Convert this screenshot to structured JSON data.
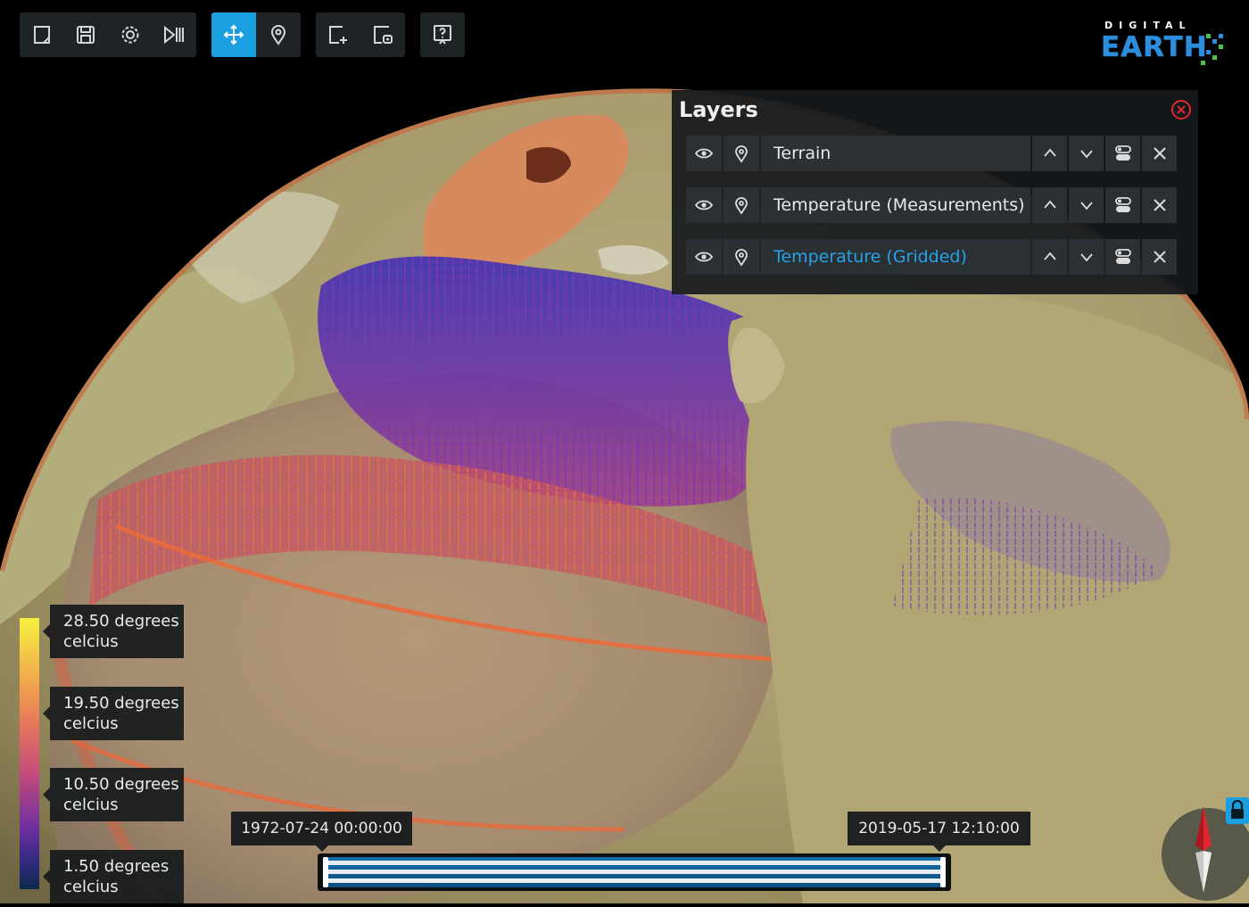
{
  "app": {
    "logo_top": "DIGITAL",
    "logo_main": "EARTH"
  },
  "toolbar": {
    "groups": [
      {
        "buttons": [
          {
            "icon": "new-document-icon",
            "active": false
          },
          {
            "icon": "save-icon",
            "active": false
          },
          {
            "icon": "gear-icon",
            "active": false
          },
          {
            "icon": "play-pause-icon",
            "active": false
          }
        ]
      },
      {
        "buttons": [
          {
            "icon": "move-icon",
            "active": true
          },
          {
            "icon": "map-pin-icon",
            "active": false
          }
        ]
      },
      {
        "buttons": [
          {
            "icon": "add-layer-icon",
            "active": false
          },
          {
            "icon": "layer-settings-icon",
            "active": false
          }
        ]
      },
      {
        "buttons": [
          {
            "icon": "help-icon",
            "active": false
          }
        ]
      }
    ]
  },
  "layers": {
    "title": "Layers",
    "items": [
      {
        "label": "Terrain",
        "highlighted": false
      },
      {
        "label": "Temperature (Measurements)",
        "highlighted": false
      },
      {
        "label": "Temperature (Gridded)",
        "highlighted": true
      }
    ]
  },
  "legend": {
    "items": [
      {
        "line1": "28.50 degrees",
        "line2": "celcius"
      },
      {
        "line1": "19.50 degrees",
        "line2": "celcius"
      },
      {
        "line1": "10.50 degrees",
        "line2": "celcius"
      },
      {
        "line1": "1.50 degrees",
        "line2": "celcius"
      }
    ]
  },
  "time": {
    "start": "1972-07-24 00:00:00",
    "end": "2019-05-17 12:10:00",
    "range_start_fraction": 0.0,
    "range_end_fraction": 1.0
  },
  "colors": {
    "accent": "#1aa0e0",
    "highlight_text": "#24a3e6",
    "close_red": "#e0262e",
    "panel_bg": "#16191c"
  }
}
